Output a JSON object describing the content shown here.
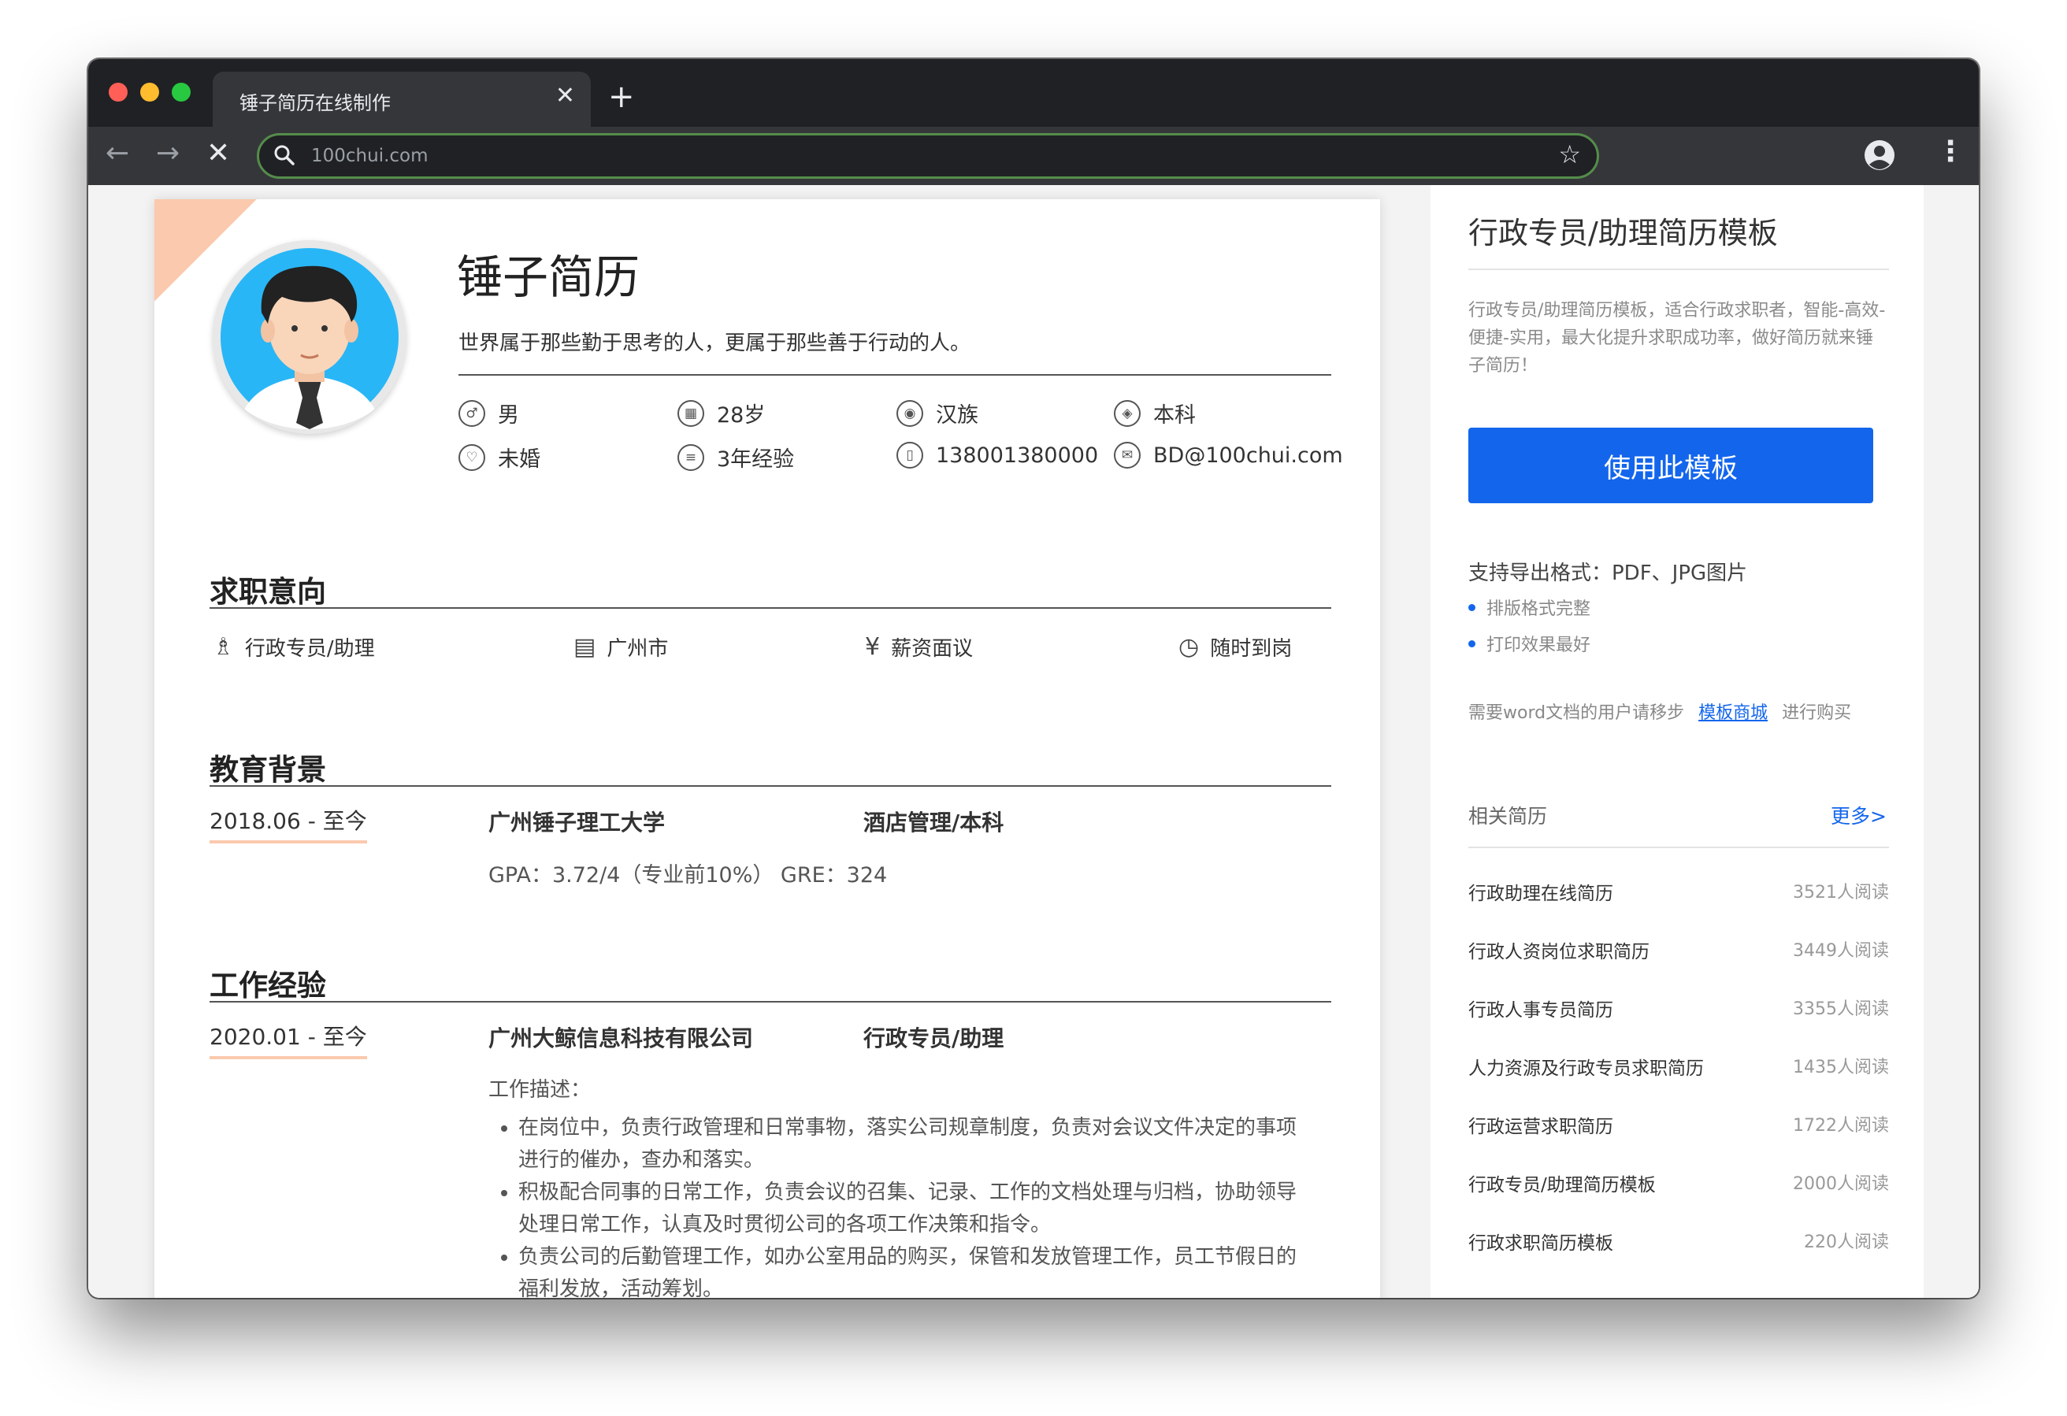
{
  "browser": {
    "tab_title": "锤子简历在线制作",
    "tab_close": "✕",
    "new_tab": "+",
    "url": "100chui.com",
    "back": "←",
    "forward": "→",
    "stop": "✕",
    "star": "☆",
    "menu": "⋮"
  },
  "resume": {
    "name": "锤子简历",
    "motto": "世界属于那些勤于思考的人，更属于那些善于行动的人。",
    "info": [
      {
        "icon": "gender-icon",
        "glyph": "♂",
        "text": "男"
      },
      {
        "icon": "age-icon",
        "glyph": "▦",
        "text": "28岁"
      },
      {
        "icon": "ethnicity-icon",
        "glyph": "◉",
        "text": "汉族"
      },
      {
        "icon": "education-icon",
        "glyph": "◈",
        "text": "本科"
      },
      {
        "icon": "marital-icon",
        "glyph": "♡",
        "text": "未婚"
      },
      {
        "icon": "experience-icon",
        "glyph": "≡",
        "text": "3年经验"
      },
      {
        "icon": "phone-icon",
        "glyph": "▯",
        "text": "138001380000"
      },
      {
        "icon": "email-icon",
        "glyph": "✉",
        "text": "BD@100chui.com"
      }
    ],
    "intent": {
      "title": "求职意向",
      "items": [
        {
          "icon": "tie-icon",
          "glyph": "♗",
          "text": "行政专员/助理"
        },
        {
          "icon": "building-icon",
          "glyph": "▤",
          "text": "广州市"
        },
        {
          "icon": "salary-icon",
          "glyph": "¥",
          "text": "薪资面议"
        },
        {
          "icon": "clock-icon",
          "glyph": "◷",
          "text": "随时到岗"
        }
      ]
    },
    "education": {
      "title": "教育背景",
      "period": "2018.06 - 至今",
      "school": "广州锤子理工大学",
      "major": "酒店管理/本科",
      "detail": "GPA：3.72/4（专业前10%） GRE：324"
    },
    "work": {
      "title": "工作经验",
      "period": "2020.01 - 至今",
      "company": "广州大鲸信息科技有限公司",
      "position": "行政专员/助理",
      "desc_label": "工作描述：",
      "duties": [
        "在岗位中，负责行政管理和日常事物，落实公司规章制度，负责对会议文件决定的事项进行的催办，查办和落实。",
        "积极配合同事的日常工作，负责会议的召集、记录、工作的文档处理与归档，协助领导处理日常工作，认真及时贯彻公司的各项工作决策和指令。",
        "负责公司的后勤管理工作，如办公室用品的购买，保管和发放管理工作，员工节假日的福利发放，活动筹划。"
      ]
    }
  },
  "sidebar": {
    "title": "行政专员/助理简历模板",
    "description": "行政专员/助理简历模板，适合行政求职者，智能-高效-便捷-实用，最大化提升求职成功率，做好简历就来锤子简历！",
    "use_button": "使用此模板",
    "formats": "支持导出格式：PDF、JPG图片",
    "bullets": [
      "排版格式完整",
      "打印效果最好"
    ],
    "word_note_prefix": "需要word文档的用户请移步",
    "word_note_link": "模板商城",
    "word_note_suffix": "进行购买",
    "related_label": "相关简历",
    "more_link": "更多>",
    "accent_color": "#1366ec",
    "related": [
      {
        "title": "行政助理在线简历",
        "reads": "3521人阅读"
      },
      {
        "title": "行政人资岗位求职简历",
        "reads": "3449人阅读"
      },
      {
        "title": "行政人事专员简历",
        "reads": "3355人阅读"
      },
      {
        "title": "人力资源及行政专员求职简历",
        "reads": "1435人阅读"
      },
      {
        "title": "行政运营求职简历",
        "reads": "1722人阅读"
      },
      {
        "title": "行政专员/助理简历模板",
        "reads": "2000人阅读"
      },
      {
        "title": "行政求职简历模板",
        "reads": "220人阅读"
      }
    ]
  }
}
